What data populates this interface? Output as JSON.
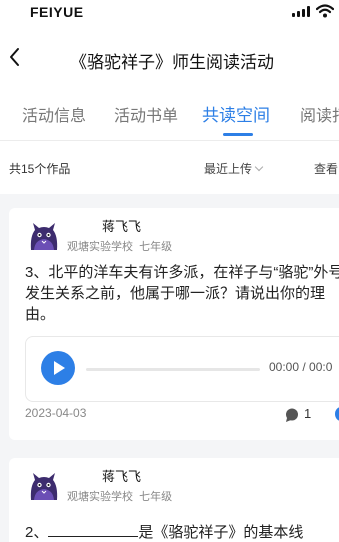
{
  "status_bar": {
    "carrier": "FEIYUE"
  },
  "header": {
    "title": "《骆驼祥子》师生阅读活动"
  },
  "tabs": [
    {
      "label": "活动信息"
    },
    {
      "label": "活动书单"
    },
    {
      "label": "共读空间"
    },
    {
      "label": "阅读打"
    }
  ],
  "active_tab": "共读空间",
  "filter": {
    "count_text": "共15个作品",
    "sort_label": "最近上传",
    "view_label": "查看"
  },
  "posts": [
    {
      "author": "蒋飞飞",
      "school": "观塘实验学校",
      "grade": "七年级",
      "text": "3、北平的洋车夫有许多派，在祥子与“骆驼”外号发生关系之前，他属于哪一派？请说出你的理由。",
      "audio_time": "00:00 / 00:0",
      "date": "2023-04-03",
      "comments": "1"
    },
    {
      "author": "蒋飞飞",
      "school": "观塘实验学校",
      "grade": "七年级",
      "text_prefix": "2、",
      "text_suffix": "是《骆驼祥子》的基本线"
    }
  ],
  "colors": {
    "accent": "#2d7fe6"
  },
  "icons": [
    "back-arrow-icon",
    "signal-icon",
    "wifi-icon",
    "play-icon",
    "comment-icon",
    "chevron-down-icon"
  ]
}
